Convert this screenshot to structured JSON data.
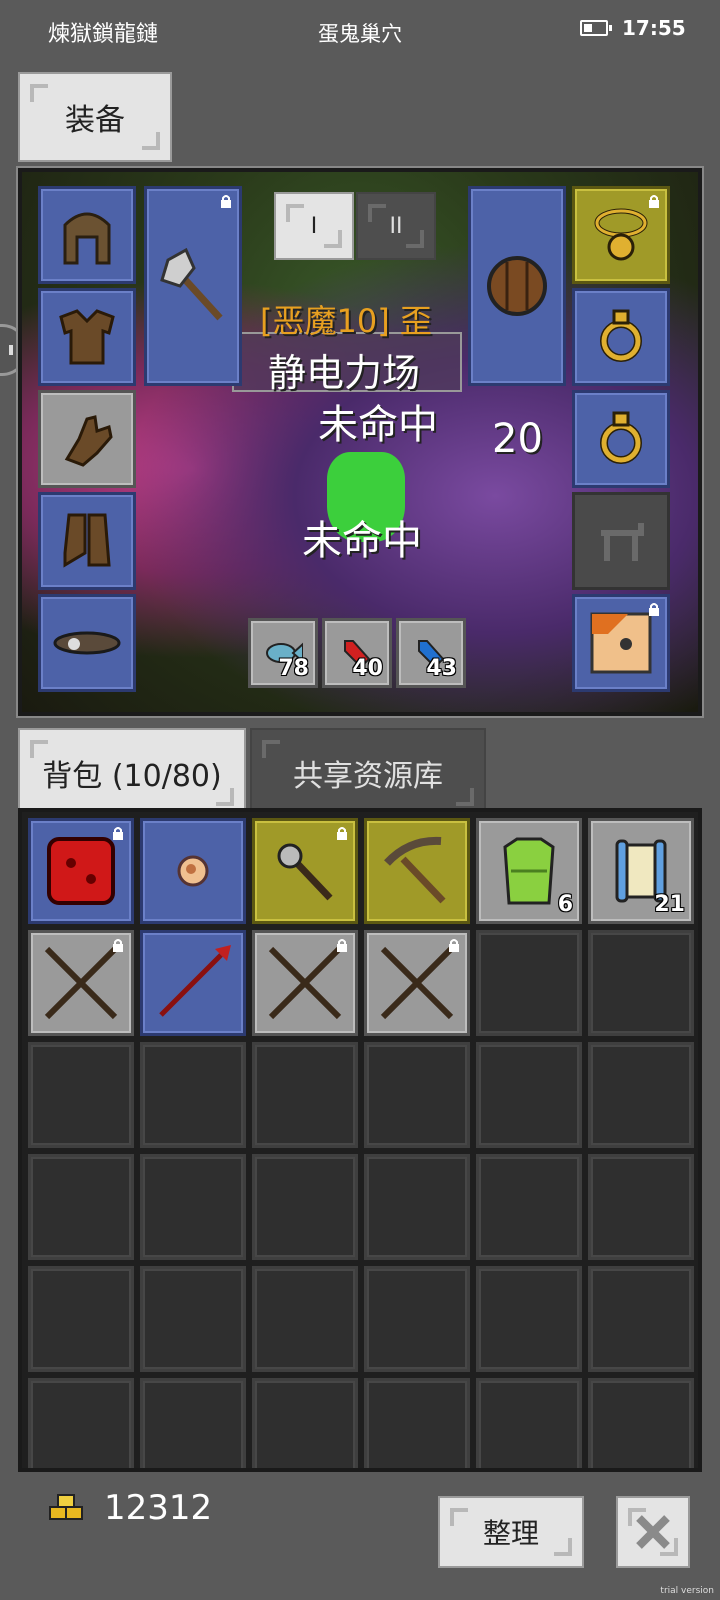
{
  "status": {
    "left_text": "煉獄鎖龍鏈",
    "center_text": "蛋鬼巢穴",
    "time": "17:55"
  },
  "equip_tab": "装备",
  "scene_text": {
    "banner": "[恶魔10] 歪",
    "spell": "静电力场",
    "miss1": "未命中",
    "miss2": "未命中",
    "damage": "20"
  },
  "quickslot_tabs": [
    "I",
    "II"
  ],
  "quick_items": [
    {
      "name": "fish",
      "qty": "78"
    },
    {
      "name": "red-potion",
      "qty": "40"
    },
    {
      "name": "blue-potion",
      "qty": "43"
    }
  ],
  "inventory_tabs": {
    "backpack": "背包 (10/80)",
    "shared": "共享资源库"
  },
  "gold": "12312",
  "sort_label": "整理",
  "trial": "trial version"
}
